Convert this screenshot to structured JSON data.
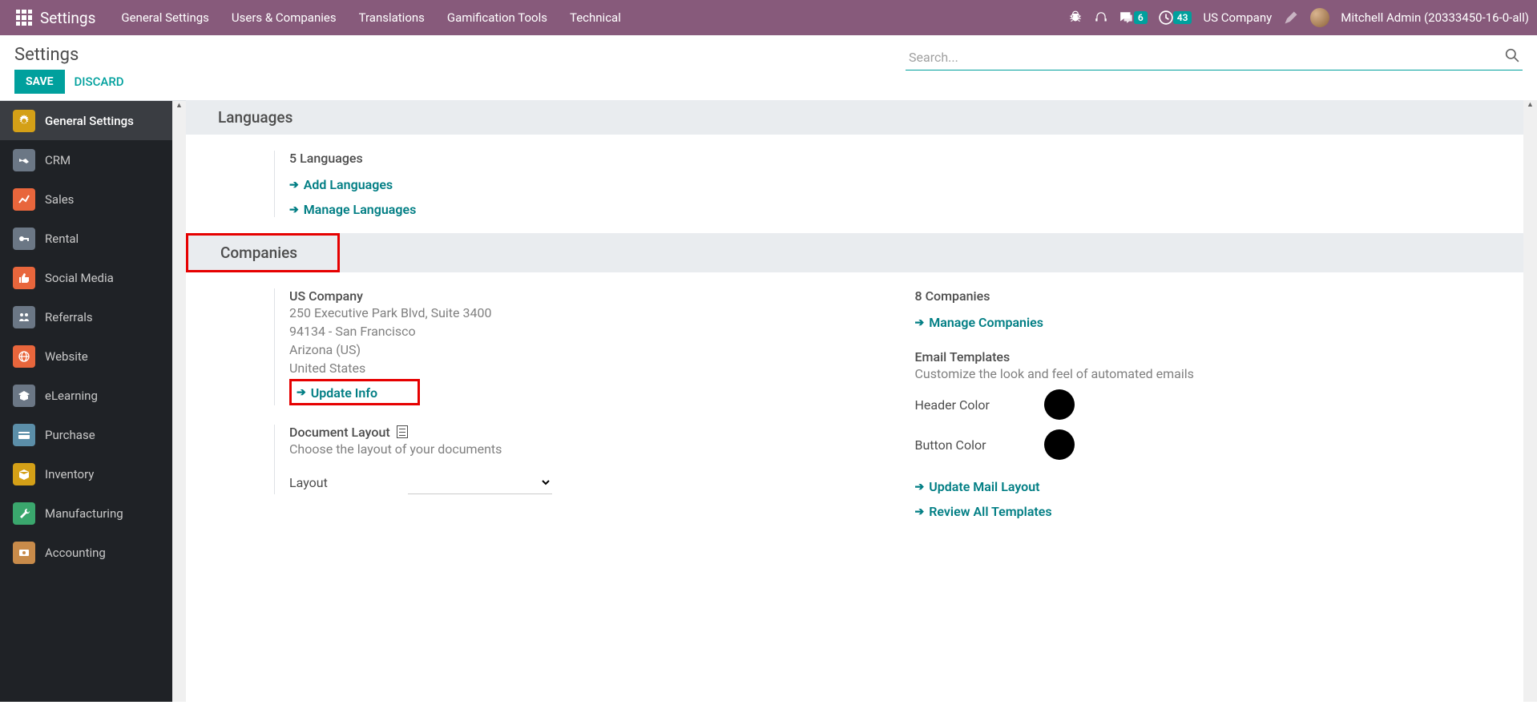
{
  "nav": {
    "title": "Settings",
    "menu": [
      "General Settings",
      "Users & Companies",
      "Translations",
      "Gamification Tools",
      "Technical"
    ],
    "messages_count": "6",
    "activities_count": "43",
    "company": "US Company",
    "user": "Mitchell Admin (20333450-16-0-all)"
  },
  "cp": {
    "title": "Settings",
    "save": "SAVE",
    "discard": "DISCARD",
    "search_placeholder": "Search..."
  },
  "sidebar": {
    "items": [
      {
        "label": "General Settings",
        "color": "#d4a017",
        "active": true
      },
      {
        "label": "CRM",
        "color": "#6b7785"
      },
      {
        "label": "Sales",
        "color": "#e8663c"
      },
      {
        "label": "Rental",
        "color": "#6b7785"
      },
      {
        "label": "Social Media",
        "color": "#e8663c"
      },
      {
        "label": "Referrals",
        "color": "#6b7785"
      },
      {
        "label": "Website",
        "color": "#e8663c"
      },
      {
        "label": "eLearning",
        "color": "#6b7785"
      },
      {
        "label": "Purchase",
        "color": "#5b8ea8"
      },
      {
        "label": "Inventory",
        "color": "#d4a017"
      },
      {
        "label": "Manufacturing",
        "color": "#3aa76d"
      },
      {
        "label": "Accounting",
        "color": "#c88b4a"
      }
    ]
  },
  "languages": {
    "header": "Languages",
    "count": "5 Languages",
    "add": "Add Languages",
    "manage": "Manage Languages"
  },
  "companies": {
    "header": "Companies",
    "name": "US Company",
    "addr1": "250 Executive Park Blvd, Suite 3400",
    "addr2": "94134 - San Francisco",
    "addr3": "Arizona (US)",
    "addr4": "United States",
    "update": "Update Info",
    "count": "8 Companies",
    "manage": "Manage Companies",
    "doc_layout_title": "Document Layout",
    "doc_layout_desc": "Choose the layout of your documents",
    "layout_label": "Layout",
    "email_title": "Email Templates",
    "email_desc": "Customize the look and feel of automated emails",
    "header_color": "Header Color",
    "button_color": "Button Color",
    "update_mail": "Update Mail Layout",
    "review_templates": "Review All Templates"
  }
}
